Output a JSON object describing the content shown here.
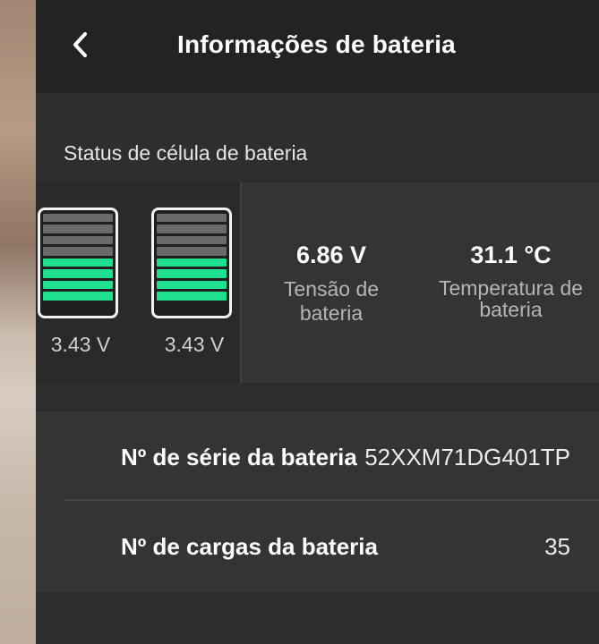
{
  "header": {
    "title": "Informações de bateria"
  },
  "section": {
    "label": "Status de célula de bateria"
  },
  "cells": [
    {
      "voltage": "3.43 V",
      "level_bars": 4,
      "total_bars": 8
    },
    {
      "voltage": "3.43 V",
      "level_bars": 4,
      "total_bars": 8
    }
  ],
  "stats": {
    "voltage": {
      "value": "6.86 V",
      "label_line1": "Tensão de",
      "label_line2": "bateria"
    },
    "temperature": {
      "value": "31.1 °C",
      "label_line1": "Temperatura de",
      "label_line2": "bateria"
    }
  },
  "info": {
    "serial": {
      "label": "Nº de série da bateria",
      "value": "52XXM71DG401TP"
    },
    "charges": {
      "label": "Nº de cargas da bateria",
      "value": "35"
    }
  },
  "colors": {
    "cell_fill": "#1fe08f",
    "cell_empty": "#6a6a6a"
  },
  "icons": {
    "back": "chevron-left-icon"
  }
}
